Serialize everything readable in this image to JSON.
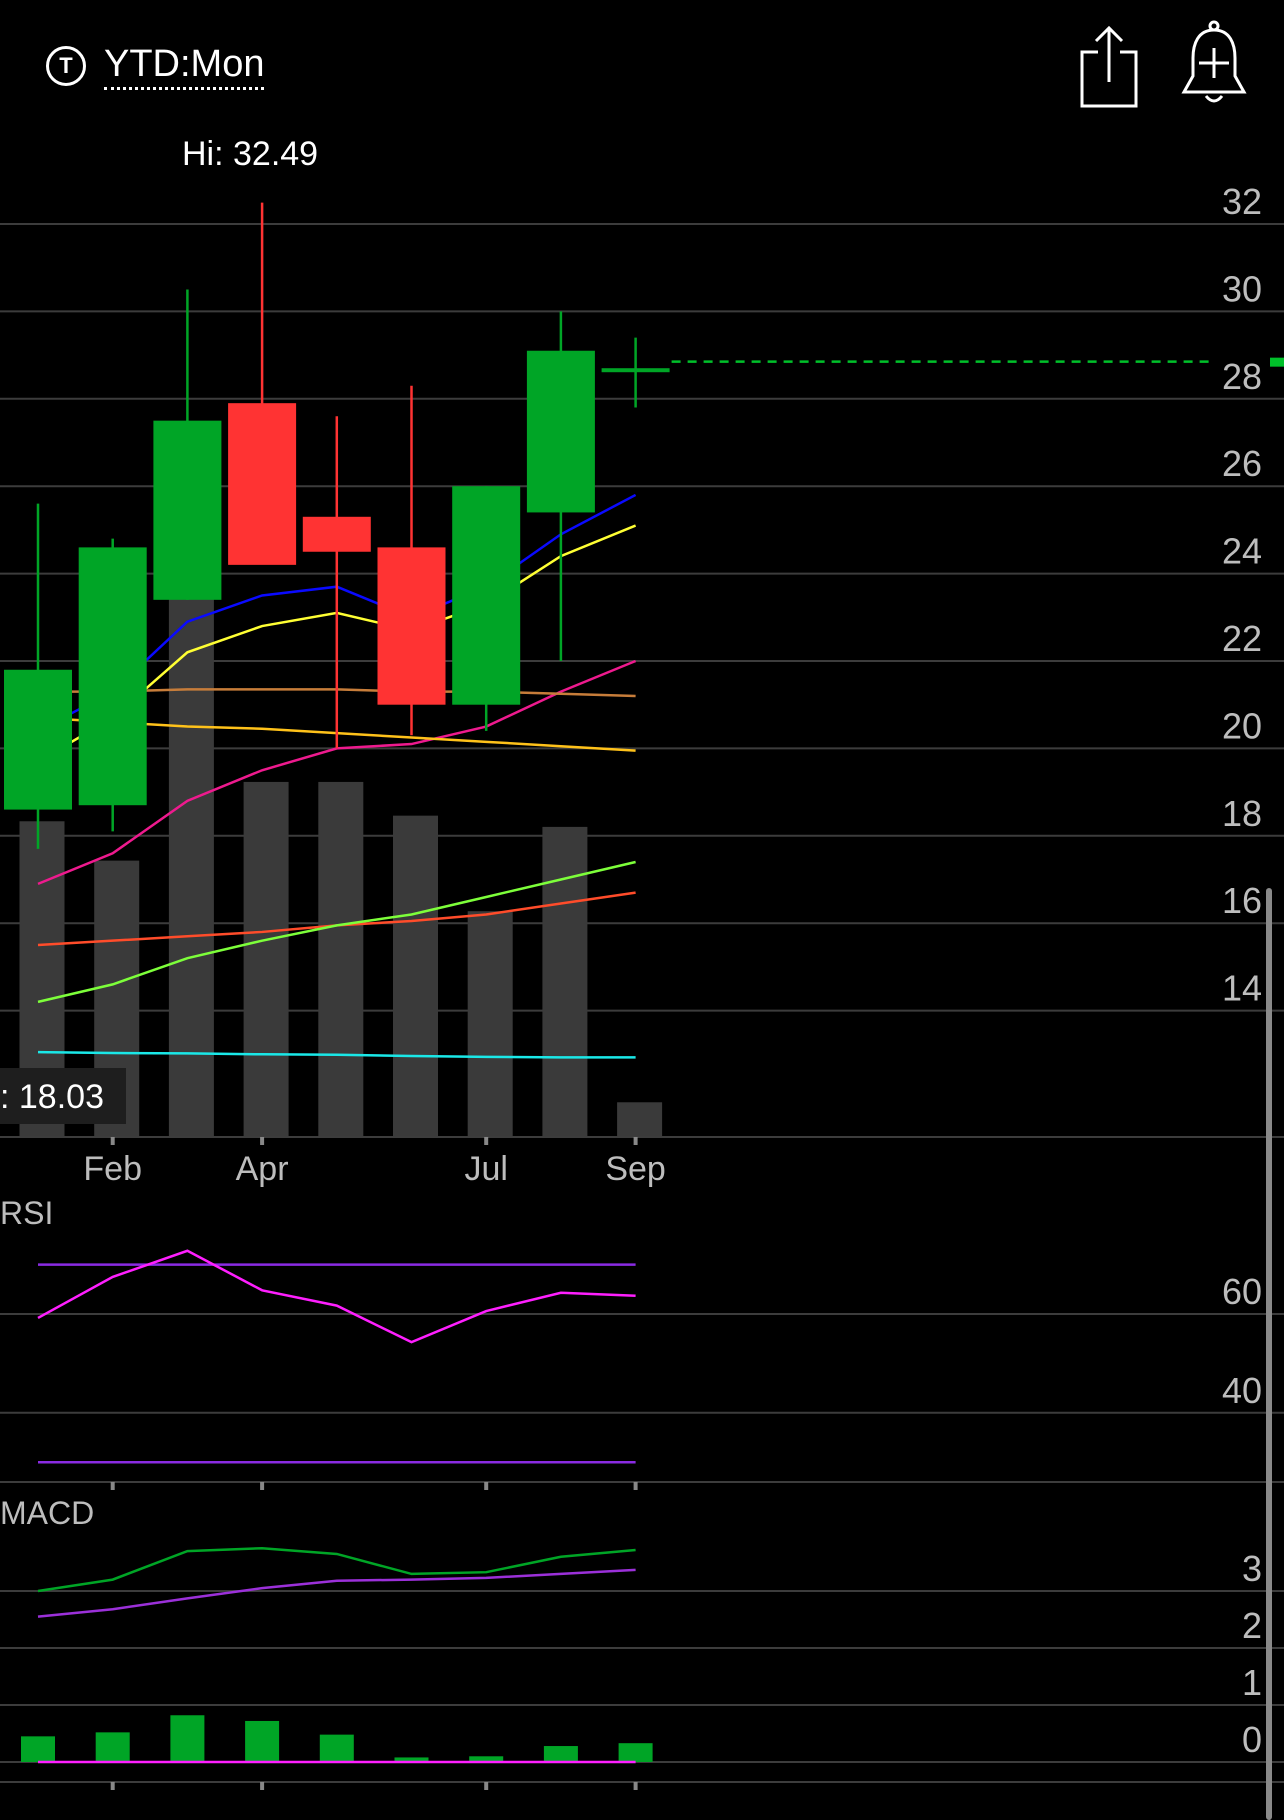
{
  "header": {
    "range_icon_letter": "T",
    "range_label": "YTD:Mon",
    "share_icon": "share-icon",
    "alert_icon": "add-alert-bell-icon"
  },
  "colors": {
    "up": "#00a526",
    "down": "#ff3333",
    "volume": "#3a3a3a",
    "grid": "#3c3c3c",
    "axis_text": "#bdbdbd",
    "current_price_line": "#00c02a"
  },
  "chart_data": [
    {
      "type": "candlestick",
      "hi_label": "Hi: 32.49",
      "lo_label": ": 18.03",
      "x_tick_labels": [
        "Feb",
        "Apr",
        "Jul",
        "Sep"
      ],
      "x_tick_indices": [
        1,
        3,
        6,
        8
      ],
      "y_ticks": [
        32,
        30,
        28,
        26,
        24,
        22,
        20,
        18,
        16,
        14
      ],
      "ylim": [
        11.2,
        33.4
      ],
      "candles": [
        {
          "open": 18.6,
          "high": 25.6,
          "low": 17.7,
          "close": 21.8
        },
        {
          "open": 18.7,
          "high": 24.8,
          "low": 18.1,
          "close": 24.6
        },
        {
          "open": 23.4,
          "high": 30.5,
          "low": 23.4,
          "close": 27.5
        },
        {
          "open": 27.9,
          "high": 32.49,
          "low": 25.2,
          "close": 24.2
        },
        {
          "open": 25.3,
          "high": 27.6,
          "low": 20.0,
          "close": 24.5
        },
        {
          "open": 24.6,
          "high": 28.3,
          "low": 20.3,
          "close": 21.0
        },
        {
          "open": 21.0,
          "high": 26.0,
          "low": 20.4,
          "close": 26.0
        },
        {
          "open": 25.4,
          "high": 30.0,
          "low": 22.0,
          "close": 29.1
        },
        {
          "open": 28.7,
          "high": 29.4,
          "low": 27.8,
          "close": 28.7
        }
      ],
      "current_price": 28.85,
      "volume": [
        0.56,
        0.49,
        0.98,
        0.63,
        0.63,
        0.57,
        0.4,
        0.55,
        0.06
      ],
      "moving_averages": [
        {
          "color": "#0a0aff",
          "values": [
            20.4,
            21.3,
            22.9,
            23.5,
            23.7,
            23.0,
            23.7,
            24.9,
            25.8
          ]
        },
        {
          "color": "#ffff33",
          "values": [
            19.7,
            20.7,
            22.2,
            22.8,
            23.1,
            22.7,
            23.3,
            24.4,
            25.1
          ]
        },
        {
          "color": "#ee1a8e",
          "values": [
            16.9,
            17.6,
            18.8,
            19.5,
            20.0,
            20.1,
            20.5,
            21.3,
            22.0
          ]
        },
        {
          "color": "#c77d3a",
          "values": [
            21.3,
            21.3,
            21.35,
            21.35,
            21.35,
            21.3,
            21.3,
            21.25,
            21.2
          ]
        },
        {
          "color": "#ffc21a",
          "values": [
            20.7,
            20.6,
            20.5,
            20.45,
            20.35,
            20.25,
            20.15,
            20.05,
            19.95
          ]
        },
        {
          "color": "#ff4c2a",
          "values": [
            15.5,
            15.6,
            15.7,
            15.8,
            15.95,
            16.05,
            16.2,
            16.45,
            16.7
          ]
        },
        {
          "color": "#7dff3a",
          "values": [
            14.2,
            14.6,
            15.2,
            15.6,
            15.95,
            16.2,
            16.6,
            17.0,
            17.4
          ]
        },
        {
          "color": "#1ae8e8",
          "values": [
            13.05,
            13.03,
            13.02,
            13.0,
            12.99,
            12.96,
            12.94,
            12.93,
            12.93
          ]
        }
      ]
    },
    {
      "type": "line",
      "title": "RSI",
      "y_ticks": [
        60,
        40
      ],
      "ylim": [
        26,
        73
      ],
      "upper_band": 70,
      "lower_band": 30,
      "band_color": "#8a2be2",
      "series": [
        {
          "color": "#ff1fff",
          "values": [
            59.2,
            67.5,
            72.8,
            64.8,
            61.7,
            54.3,
            60.6,
            64.3,
            63.7
          ]
        }
      ]
    },
    {
      "type": "macd",
      "title": "MACD",
      "y_ticks": [
        3,
        2,
        1,
        0
      ],
      "ylim": [
        -0.4,
        4.2
      ],
      "series": [
        {
          "color": "#00a526",
          "values": [
            3.0,
            3.2,
            3.7,
            3.75,
            3.65,
            3.3,
            3.33,
            3.6,
            3.72
          ]
        },
        {
          "color": "#9b30d9",
          "values": [
            2.55,
            2.68,
            2.87,
            3.05,
            3.18,
            3.2,
            3.23,
            3.3,
            3.37
          ]
        }
      ],
      "histogram": [
        0.45,
        0.52,
        0.82,
        0.72,
        0.48,
        0.08,
        0.1,
        0.28,
        0.33
      ],
      "histogram_color": "#00a526",
      "zero_line_color": "#ff1fff"
    }
  ]
}
